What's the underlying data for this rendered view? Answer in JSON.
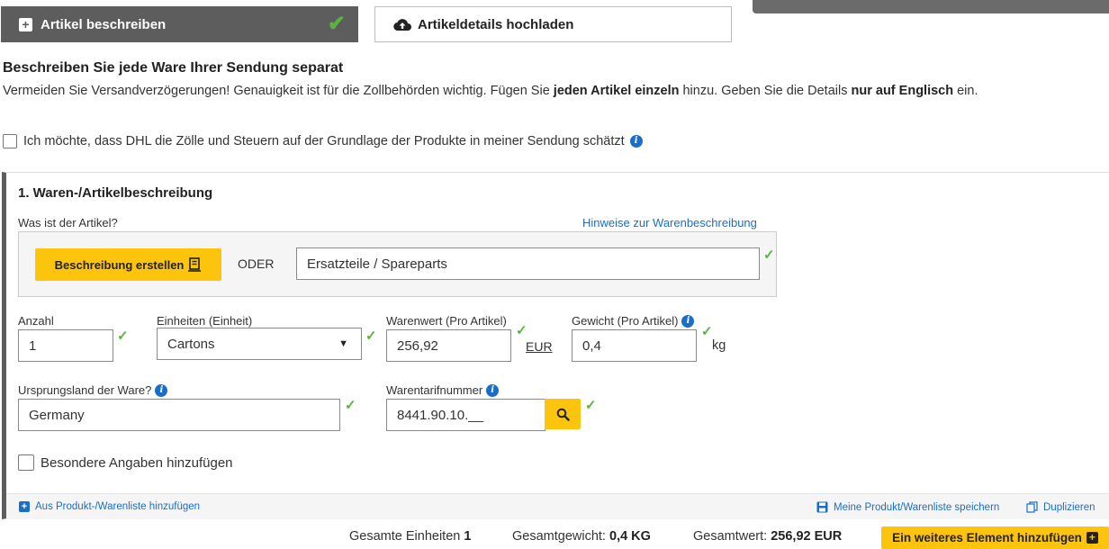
{
  "tabs": {
    "describe": "Artikel beschreiben",
    "upload": "Artikeldetails hochladen"
  },
  "heading": "Beschreiben Sie jede Ware Ihrer Sendung separat",
  "description": {
    "part1": "Vermeiden Sie Versandverzögerungen! Genauigkeit ist für die Zollbehörden wichtig.  Fügen Sie ",
    "bold1": "jeden Artikel einzeln",
    "part2": " hinzu.  Geben Sie die Details ",
    "bold2": "nur auf Englisch",
    "part3": " ein."
  },
  "estimate_checkbox_label": "Ich möchte, dass DHL die Zölle und Steuern auf der Grundlage der Produkte in meiner Sendung schätzt",
  "item": {
    "section_title": "1. Waren-/Artikelbeschreibung",
    "what_label": "Was ist der Artikel?",
    "hint_link": "Hinweise zur Warenbeschreibung",
    "create_button": "Beschreibung erstellen",
    "oder": "ODER",
    "description_value": "Ersatzteile / Spareparts",
    "quantity_label": "Anzahl",
    "quantity_value": "1",
    "units_label": "Einheiten (Einheit)",
    "units_value": "Cartons",
    "value_label": "Warenwert (Pro Artikel)",
    "value_value": "256,92",
    "currency": "EUR",
    "weight_label": "Gewicht (Pro Artikel)",
    "weight_value": "0,4",
    "weight_unit": "kg",
    "country_label": "Ursprungsland der Ware?",
    "country_value": "Germany",
    "tariff_label": "Warentarifnummer",
    "tariff_value": "8441.90.10.__",
    "special_label": "Besondere Angaben hinzufügen",
    "add_from_list": "Aus Produkt-/Warenliste hinzufügen",
    "save_list": "Meine Produkt/Warenliste speichern",
    "duplicate": "Duplizieren"
  },
  "totals": {
    "units_label": "Gesamte Einheiten",
    "units_value": "1",
    "weight_label": "Gesamtgewicht:",
    "weight_value": "0,4 KG",
    "value_label": "Gesamtwert:",
    "value_value": "256,92 EUR"
  },
  "add_another_button": "Ein weiteres Element hinzufügen"
}
